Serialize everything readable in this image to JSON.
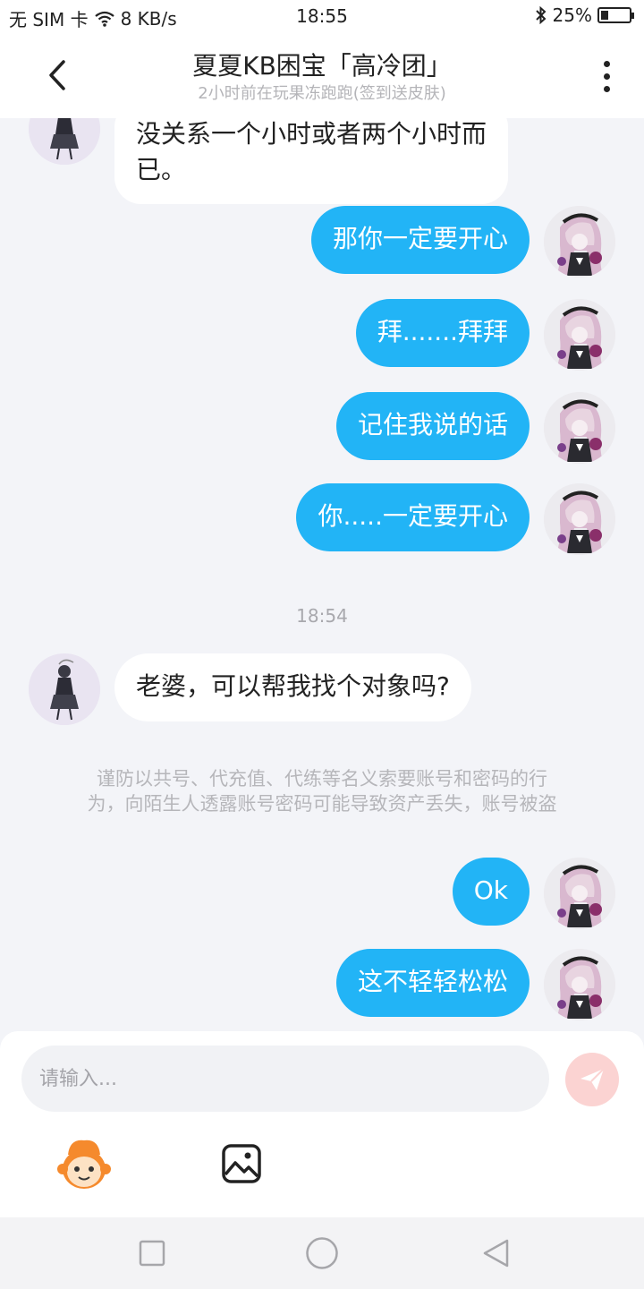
{
  "status_bar": {
    "carrier": "无 SIM 卡",
    "speed": "8 KB/s",
    "time": "18:55",
    "battery": "25%",
    "battery_level": 0.25
  },
  "header": {
    "title": "夏夏KB困宝「高冷团」",
    "subtitle": "2小时前在玩果冻跑跑(签到送皮肤)"
  },
  "messages": [
    {
      "side": "left",
      "text_line1": "没关系一个小时或者两个小时而",
      "text_line2": "已。"
    },
    {
      "side": "right",
      "text": "那你一定要开心"
    },
    {
      "side": "right",
      "text": "拜.......拜拜"
    },
    {
      "side": "right",
      "text": "记住我说的话"
    },
    {
      "side": "right",
      "text": "你.....一定要开心"
    },
    {
      "side": "time",
      "text": "18:54"
    },
    {
      "side": "left",
      "text": "老婆，可以帮我找个对象吗?"
    },
    {
      "side": "notice",
      "text_line1": "谨防以共号、代充值、代练等名义索要账号和密码的行",
      "text_line2": "为，向陌生人透露账号密码可能导致资产丢失，账号被盗"
    },
    {
      "side": "right",
      "text": "Ok"
    },
    {
      "side": "right",
      "text": "这不轻轻松松"
    }
  ],
  "input": {
    "placeholder": "请输入..."
  },
  "colors": {
    "accent": "#22b4f6",
    "background": "#f3f4f8",
    "send_disabled": "#fbd3d2"
  },
  "icons": {
    "back": "chevron-left-icon",
    "more": "more-vertical-icon",
    "send": "paper-plane-icon",
    "emoji": "emoji-face-icon",
    "image": "image-icon",
    "nav_recent": "square-icon",
    "nav_home": "circle-icon",
    "nav_back": "triangle-icon"
  }
}
